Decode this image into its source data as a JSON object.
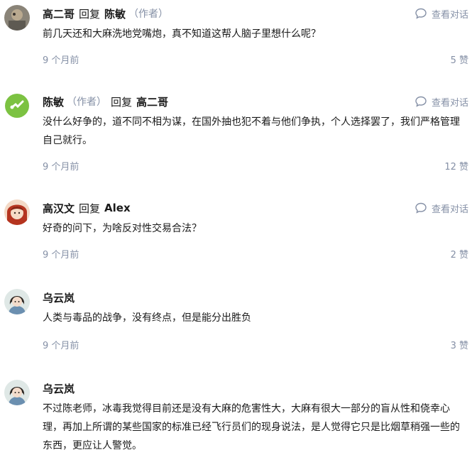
{
  "view_conversation_label": "查看对话",
  "comments": [
    {
      "author": "高二哥",
      "reply_word": "回复",
      "reply_to": "陈敏",
      "reply_to_tag": "（作者）",
      "text": "前几天还和大麻洗地党嘴炮，真不知道这帮人脑子里想什么呢？",
      "time": "9 个月前",
      "likes": "5 赞"
    },
    {
      "author": "陈敏",
      "author_tag": "（作者）",
      "reply_word": "回复",
      "reply_to": "高二哥",
      "text": "没什么好争的，道不同不相为谋，在国外抽也犯不着与他们争执，个人选择罢了，我们严格管理自己就行。",
      "time": "9 个月前",
      "likes": "12 赞"
    },
    {
      "author": "高汉文",
      "reply_word": "回复",
      "reply_to": "Alex",
      "text": "好奇的问下，为啥反对性交易合法？",
      "time": "9 个月前",
      "likes": "2 赞"
    },
    {
      "author": "乌云岚",
      "text": "人类与毒品的战争，没有终点，但是能分出胜负",
      "time": "9 个月前",
      "likes": "3 赞"
    },
    {
      "author": "乌云岚",
      "text": "不过陈老师，冰毒我觉得目前还是没有大麻的危害性大，大麻有很大一部分的盲从性和侥幸心理，再加上所谓的某些国家的标准已经飞行员们的现身说法，是人觉得它只是比烟草稍强一些的东西，更应让人警觉。"
    }
  ]
}
